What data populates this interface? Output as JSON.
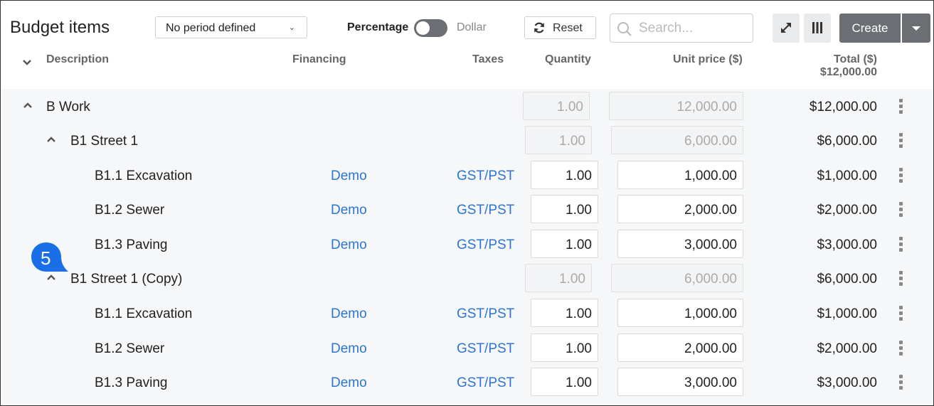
{
  "toolbar": {
    "title": "Budget items",
    "period": "No period defined",
    "percentage_label": "Percentage",
    "dollar_label": "Dollar",
    "reset_label": "Reset",
    "search_placeholder": "Search...",
    "create_label": "Create"
  },
  "header": {
    "description": "Description",
    "financing": "Financing",
    "taxes": "Taxes",
    "quantity": "Quantity",
    "unit_price": "Unit price ($)",
    "total": "Total ($)",
    "grand_total": "$12,000.00"
  },
  "rows": [
    {
      "description": "B Work",
      "financing": "",
      "taxes": "",
      "quantity": "1.00",
      "unit_price": "12,000.00",
      "total": "$12,000.00"
    },
    {
      "description": "B1 Street 1",
      "financing": "",
      "taxes": "",
      "quantity": "1.00",
      "unit_price": "6,000.00",
      "total": "$6,000.00"
    },
    {
      "description": "B1.1 Excavation",
      "financing": "Demo",
      "taxes": "GST/PST",
      "quantity": "1.00",
      "unit_price": "1,000.00",
      "total": "$1,000.00"
    },
    {
      "description": "B1.2 Sewer",
      "financing": "Demo",
      "taxes": "GST/PST",
      "quantity": "1.00",
      "unit_price": "2,000.00",
      "total": "$2,000.00"
    },
    {
      "description": "B1.3 Paving",
      "financing": "Demo",
      "taxes": "GST/PST",
      "quantity": "1.00",
      "unit_price": "3,000.00",
      "total": "$3,000.00"
    },
    {
      "description": "B1 Street 1 (Copy)",
      "financing": "",
      "taxes": "",
      "quantity": "1.00",
      "unit_price": "6,000.00",
      "total": "$6,000.00"
    },
    {
      "description": "B1.1 Excavation",
      "financing": "Demo",
      "taxes": "GST/PST",
      "quantity": "1.00",
      "unit_price": "1,000.00",
      "total": "$1,000.00"
    },
    {
      "description": "B1.2 Sewer",
      "financing": "Demo",
      "taxes": "GST/PST",
      "quantity": "1.00",
      "unit_price": "2,000.00",
      "total": "$2,000.00"
    },
    {
      "description": "B1.3 Paving",
      "financing": "Demo",
      "taxes": "GST/PST",
      "quantity": "1.00",
      "unit_price": "3,000.00",
      "total": "$3,000.00"
    }
  ],
  "step_badge": "5",
  "icons": {
    "reset": "refresh-icon",
    "search": "search-icon",
    "expand": "expand-icon",
    "columns": "columns-icon",
    "create_menu": "caret-down-icon",
    "row_menu": "more-vertical-icon"
  },
  "colors": {
    "link": "#2d74d4",
    "button": "#6b6e72",
    "badge": "#1a6ee6"
  }
}
